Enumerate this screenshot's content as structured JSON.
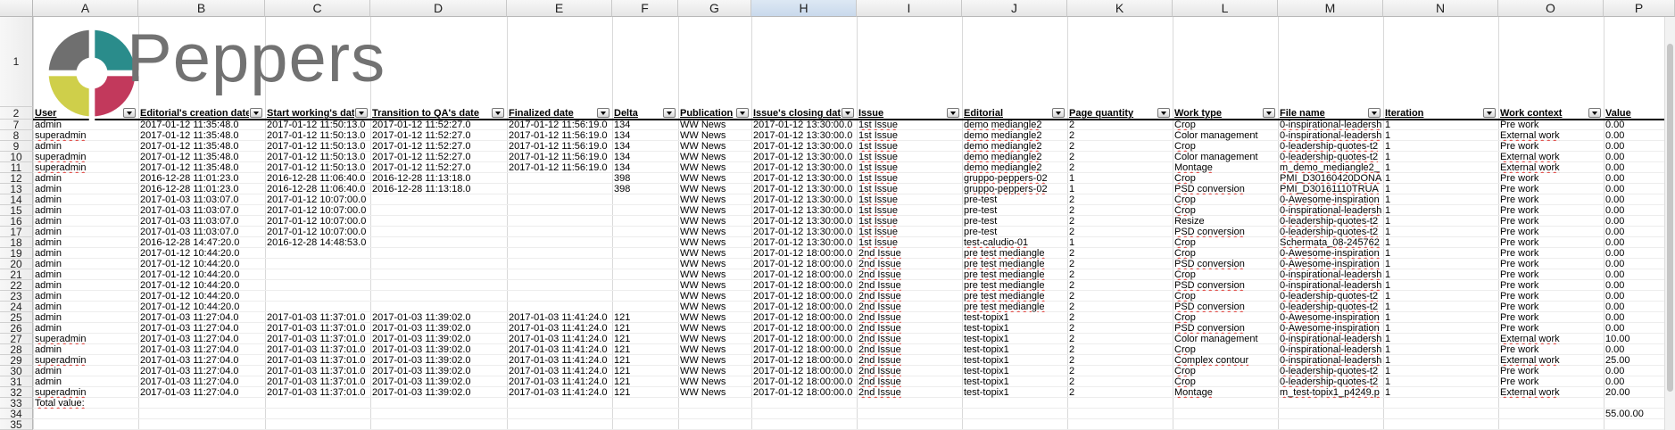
{
  "app": {
    "logo_text": "Peppers"
  },
  "columns": [
    "A",
    "B",
    "C",
    "D",
    "E",
    "F",
    "G",
    "H",
    "I",
    "J",
    "K",
    "L",
    "M",
    "N",
    "O",
    "P"
  ],
  "selected_column": "H",
  "row_numbers": [
    "1",
    "2",
    "7",
    "8",
    "9",
    "10",
    "11",
    "12",
    "13",
    "14",
    "15",
    "16",
    "17",
    "18",
    "19",
    "20",
    "21",
    "22",
    "23",
    "24",
    "25",
    "26",
    "27",
    "28",
    "29",
    "30",
    "31",
    "32",
    "33",
    "34",
    "35"
  ],
  "headers": [
    "User",
    "Editorial's creation date",
    "Start working's date",
    "Transition to QA's date",
    "Finalized date",
    "Delta",
    "Publication",
    "Issue's closing date",
    "Issue",
    "Editorial",
    "Page quantity",
    "Work type",
    "File name",
    "Iteration",
    "Work context",
    "Value"
  ],
  "rows": [
    {
      "num": "7",
      "cells": [
        "admin",
        "2017-01-12 11:35:48.0",
        "2017-01-12 11:50:13.0",
        "2017-01-12 11:52:27.0",
        "2017-01-12 11:56:19.0",
        "134",
        "WW News",
        "2017-01-12 13:30:00.0",
        "1st Issue",
        "demo mediangle2",
        "2",
        "Crop",
        "0-inspirational-leadersh",
        "1",
        "Pre work",
        "0.00"
      ]
    },
    {
      "num": "8",
      "cells": [
        "superadmin",
        "2017-01-12 11:35:48.0",
        "2017-01-12 11:50:13.0",
        "2017-01-12 11:52:27.0",
        "2017-01-12 11:56:19.0",
        "134",
        "WW News",
        "2017-01-12 13:30:00.0",
        "1st Issue",
        "demo mediangle2",
        "2",
        "Color management",
        "0-inspirational-leadersh",
        "1",
        "External work",
        "0.00"
      ]
    },
    {
      "num": "9",
      "cells": [
        "admin",
        "2017-01-12 11:35:48.0",
        "2017-01-12 11:50:13.0",
        "2017-01-12 11:52:27.0",
        "2017-01-12 11:56:19.0",
        "134",
        "WW News",
        "2017-01-12 13:30:00.0",
        "1st Issue",
        "demo mediangle2",
        "2",
        "Crop",
        "0-leadership-quotes-t2",
        "1",
        "Pre work",
        "0.00"
      ]
    },
    {
      "num": "10",
      "cells": [
        "superadmin",
        "2017-01-12 11:35:48.0",
        "2017-01-12 11:50:13.0",
        "2017-01-12 11:52:27.0",
        "2017-01-12 11:56:19.0",
        "134",
        "WW News",
        "2017-01-12 13:30:00.0",
        "1st Issue",
        "demo mediangle2",
        "2",
        "Color management",
        "0-leadership-quotes-t2",
        "1",
        "External work",
        "0.00"
      ]
    },
    {
      "num": "11",
      "cells": [
        "superadmin",
        "2017-01-12 11:35:48.0",
        "2017-01-12 11:50:13.0",
        "2017-01-12 11:52:27.0",
        "2017-01-12 11:56:19.0",
        "134",
        "WW News",
        "2017-01-12 13:30:00.0",
        "1st Issue",
        "demo mediangle2",
        "2",
        "Montage",
        "m_demo_mediangle2_",
        "1",
        "External work",
        "0.00"
      ]
    },
    {
      "num": "12",
      "cells": [
        "admin",
        "2016-12-28 11:01:23.0",
        "2016-12-28 11:06:40.0",
        "2016-12-28 11:13:18.0",
        "",
        "398",
        "WW News",
        "2017-01-12 13:30:00.0",
        "1st Issue",
        "gruppo-peppers-02",
        "1",
        "Crop",
        "PMI_D30160420DONA",
        "1",
        "Pre work",
        "0.00"
      ]
    },
    {
      "num": "13",
      "cells": [
        "admin",
        "2016-12-28 11:01:23.0",
        "2016-12-28 11:06:40.0",
        "2016-12-28 11:13:18.0",
        "",
        "398",
        "WW News",
        "2017-01-12 13:30:00.0",
        "1st Issue",
        "gruppo-peppers-02",
        "1",
        "PSD conversion",
        "PMI_D30161110TRUA",
        "1",
        "Pre work",
        "0.00"
      ]
    },
    {
      "num": "14",
      "cells": [
        "admin",
        "2017-01-03 11:03:07.0",
        "2017-01-12 10:07:00.0",
        "",
        "",
        "",
        "WW News",
        "2017-01-12 13:30:00.0",
        "1st Issue",
        "pre-test",
        "2",
        "Crop",
        "0-Awesome-inspiration",
        "1",
        "Pre work",
        "0.00"
      ]
    },
    {
      "num": "15",
      "cells": [
        "admin",
        "2017-01-03 11:03:07.0",
        "2017-01-12 10:07:00.0",
        "",
        "",
        "",
        "WW News",
        "2017-01-12 13:30:00.0",
        "1st Issue",
        "pre-test",
        "2",
        "Crop",
        "0-inspirational-leadersh",
        "1",
        "Pre work",
        "0.00"
      ]
    },
    {
      "num": "16",
      "cells": [
        "admin",
        "2017-01-03 11:03:07.0",
        "2017-01-12 10:07:00.0",
        "",
        "",
        "",
        "WW News",
        "2017-01-12 13:30:00.0",
        "1st Issue",
        "pre-test",
        "2",
        "Resize",
        "0-leadership-quotes-t2",
        "1",
        "Pre work",
        "0.00"
      ]
    },
    {
      "num": "17",
      "cells": [
        "admin",
        "2017-01-03 11:03:07.0",
        "2017-01-12 10:07:00.0",
        "",
        "",
        "",
        "WW News",
        "2017-01-12 13:30:00.0",
        "1st Issue",
        "pre-test",
        "2",
        "PSD conversion",
        "0-leadership-quotes-t2",
        "1",
        "Pre work",
        "0.00"
      ]
    },
    {
      "num": "18",
      "cells": [
        "admin",
        "2016-12-28 14:47:20.0",
        "2016-12-28 14:48:53.0",
        "",
        "",
        "",
        "WW News",
        "2017-01-12 13:30:00.0",
        "1st Issue",
        "test-caludio-01",
        "1",
        "Crop",
        "Schermata_08-245762",
        "1",
        "Pre work",
        "0.00"
      ]
    },
    {
      "num": "19",
      "cells": [
        "admin",
        "2017-01-12 10:44:20.0",
        "",
        "",
        "",
        "",
        "WW News",
        "2017-01-12 18:00:00.0",
        "2nd Issue",
        "pre test mediangle",
        "2",
        "Crop",
        "0-Awesome-inspiration",
        "1",
        "Pre work",
        "0.00"
      ]
    },
    {
      "num": "20",
      "cells": [
        "admin",
        "2017-01-12 10:44:20.0",
        "",
        "",
        "",
        "",
        "WW News",
        "2017-01-12 18:00:00.0",
        "2nd Issue",
        "pre test mediangle",
        "2",
        "PSD conversion",
        "0-Awesome-inspiration",
        "1",
        "Pre work",
        "0.00"
      ]
    },
    {
      "num": "21",
      "cells": [
        "admin",
        "2017-01-12 10:44:20.0",
        "",
        "",
        "",
        "",
        "WW News",
        "2017-01-12 18:00:00.0",
        "2nd Issue",
        "pre test mediangle",
        "2",
        "Crop",
        "0-inspirational-leadersh",
        "1",
        "Pre work",
        "0.00"
      ]
    },
    {
      "num": "22",
      "cells": [
        "admin",
        "2017-01-12 10:44:20.0",
        "",
        "",
        "",
        "",
        "WW News",
        "2017-01-12 18:00:00.0",
        "2nd Issue",
        "pre test mediangle",
        "2",
        "PSD conversion",
        "0-inspirational-leadersh",
        "1",
        "Pre work",
        "0.00"
      ]
    },
    {
      "num": "23",
      "cells": [
        "admin",
        "2017-01-12 10:44:20.0",
        "",
        "",
        "",
        "",
        "WW News",
        "2017-01-12 18:00:00.0",
        "2nd Issue",
        "pre test mediangle",
        "2",
        "Crop",
        "0-leadership-quotes-t2",
        "1",
        "Pre work",
        "0.00"
      ]
    },
    {
      "num": "24",
      "cells": [
        "admin",
        "2017-01-12 10:44:20.0",
        "",
        "",
        "",
        "",
        "WW News",
        "2017-01-12 18:00:00.0",
        "2nd Issue",
        "pre test mediangle",
        "2",
        "PSD conversion",
        "0-leadership-quotes-t2",
        "1",
        "Pre work",
        "0.00"
      ]
    },
    {
      "num": "25",
      "cells": [
        "admin",
        "2017-01-03 11:27:04.0",
        "2017-01-03 11:37:01.0",
        "2017-01-03 11:39:02.0",
        "2017-01-03 11:41:24.0",
        "121",
        "WW News",
        "2017-01-12 18:00:00.0",
        "2nd Issue",
        "test-topix1",
        "2",
        "Crop",
        "0-Awesome-inspiration",
        "1",
        "Pre work",
        "0.00"
      ]
    },
    {
      "num": "26",
      "cells": [
        "admin",
        "2017-01-03 11:27:04.0",
        "2017-01-03 11:37:01.0",
        "2017-01-03 11:39:02.0",
        "2017-01-03 11:41:24.0",
        "121",
        "WW News",
        "2017-01-12 18:00:00.0",
        "2nd Issue",
        "test-topix1",
        "2",
        "PSD conversion",
        "0-Awesome-inspiration",
        "1",
        "Pre work",
        "0.00"
      ]
    },
    {
      "num": "27",
      "cells": [
        "superadmin",
        "2017-01-03 11:27:04.0",
        "2017-01-03 11:37:01.0",
        "2017-01-03 11:39:02.0",
        "2017-01-03 11:41:24.0",
        "121",
        "WW News",
        "2017-01-12 18:00:00.0",
        "2nd Issue",
        "test-topix1",
        "2",
        "Color management",
        "0-inspirational-leadersh",
        "1",
        "External work",
        "10.00"
      ]
    },
    {
      "num": "28",
      "cells": [
        "admin",
        "2017-01-03 11:27:04.0",
        "2017-01-03 11:37:01.0",
        "2017-01-03 11:39:02.0",
        "2017-01-03 11:41:24.0",
        "121",
        "WW News",
        "2017-01-12 18:00:00.0",
        "2nd Issue",
        "test-topix1",
        "2",
        "Crop",
        "0-inspirational-leadersh",
        "1",
        "Pre work",
        "0.00"
      ]
    },
    {
      "num": "29",
      "cells": [
        "superadmin",
        "2017-01-03 11:27:04.0",
        "2017-01-03 11:37:01.0",
        "2017-01-03 11:39:02.0",
        "2017-01-03 11:41:24.0",
        "121",
        "WW News",
        "2017-01-12 18:00:00.0",
        "2nd Issue",
        "test-topix1",
        "2",
        "Complex contour",
        "0-inspirational-leadersh",
        "1",
        "External work",
        "25.00"
      ]
    },
    {
      "num": "30",
      "cells": [
        "admin",
        "2017-01-03 11:27:04.0",
        "2017-01-03 11:37:01.0",
        "2017-01-03 11:39:02.0",
        "2017-01-03 11:41:24.0",
        "121",
        "WW News",
        "2017-01-12 18:00:00.0",
        "2nd Issue",
        "test-topix1",
        "2",
        "Crop",
        "0-leadership-quotes-t2",
        "1",
        "Pre work",
        "0.00"
      ]
    },
    {
      "num": "31",
      "cells": [
        "admin",
        "2017-01-03 11:27:04.0",
        "2017-01-03 11:37:01.0",
        "2017-01-03 11:39:02.0",
        "2017-01-03 11:41:24.0",
        "121",
        "WW News",
        "2017-01-12 18:00:00.0",
        "2nd Issue",
        "test-topix1",
        "2",
        "Crop",
        "0-leadership-quotes-t2",
        "1",
        "Pre work",
        "0.00"
      ]
    },
    {
      "num": "32",
      "cells": [
        "superadmin",
        "2017-01-03 11:27:04.0",
        "2017-01-03 11:37:01.0",
        "2017-01-03 11:39:02.0",
        "2017-01-03 11:41:24.0",
        "121",
        "WW News",
        "2017-01-12 18:00:00.0",
        "2nd Issue",
        "test-topix1",
        "2",
        "Montage",
        "m_test-topix1_p4249.p",
        "1",
        "External work",
        "20.00"
      ]
    }
  ],
  "total_label": "Total value:",
  "total_value": "55.00.00",
  "colors": {
    "logo_teal": "#2a8c8b",
    "logo_magenta": "#c2395c",
    "logo_yellow": "#cfcf4a",
    "logo_gray": "#6f6f6f",
    "spellcheck": "#e0443f"
  }
}
